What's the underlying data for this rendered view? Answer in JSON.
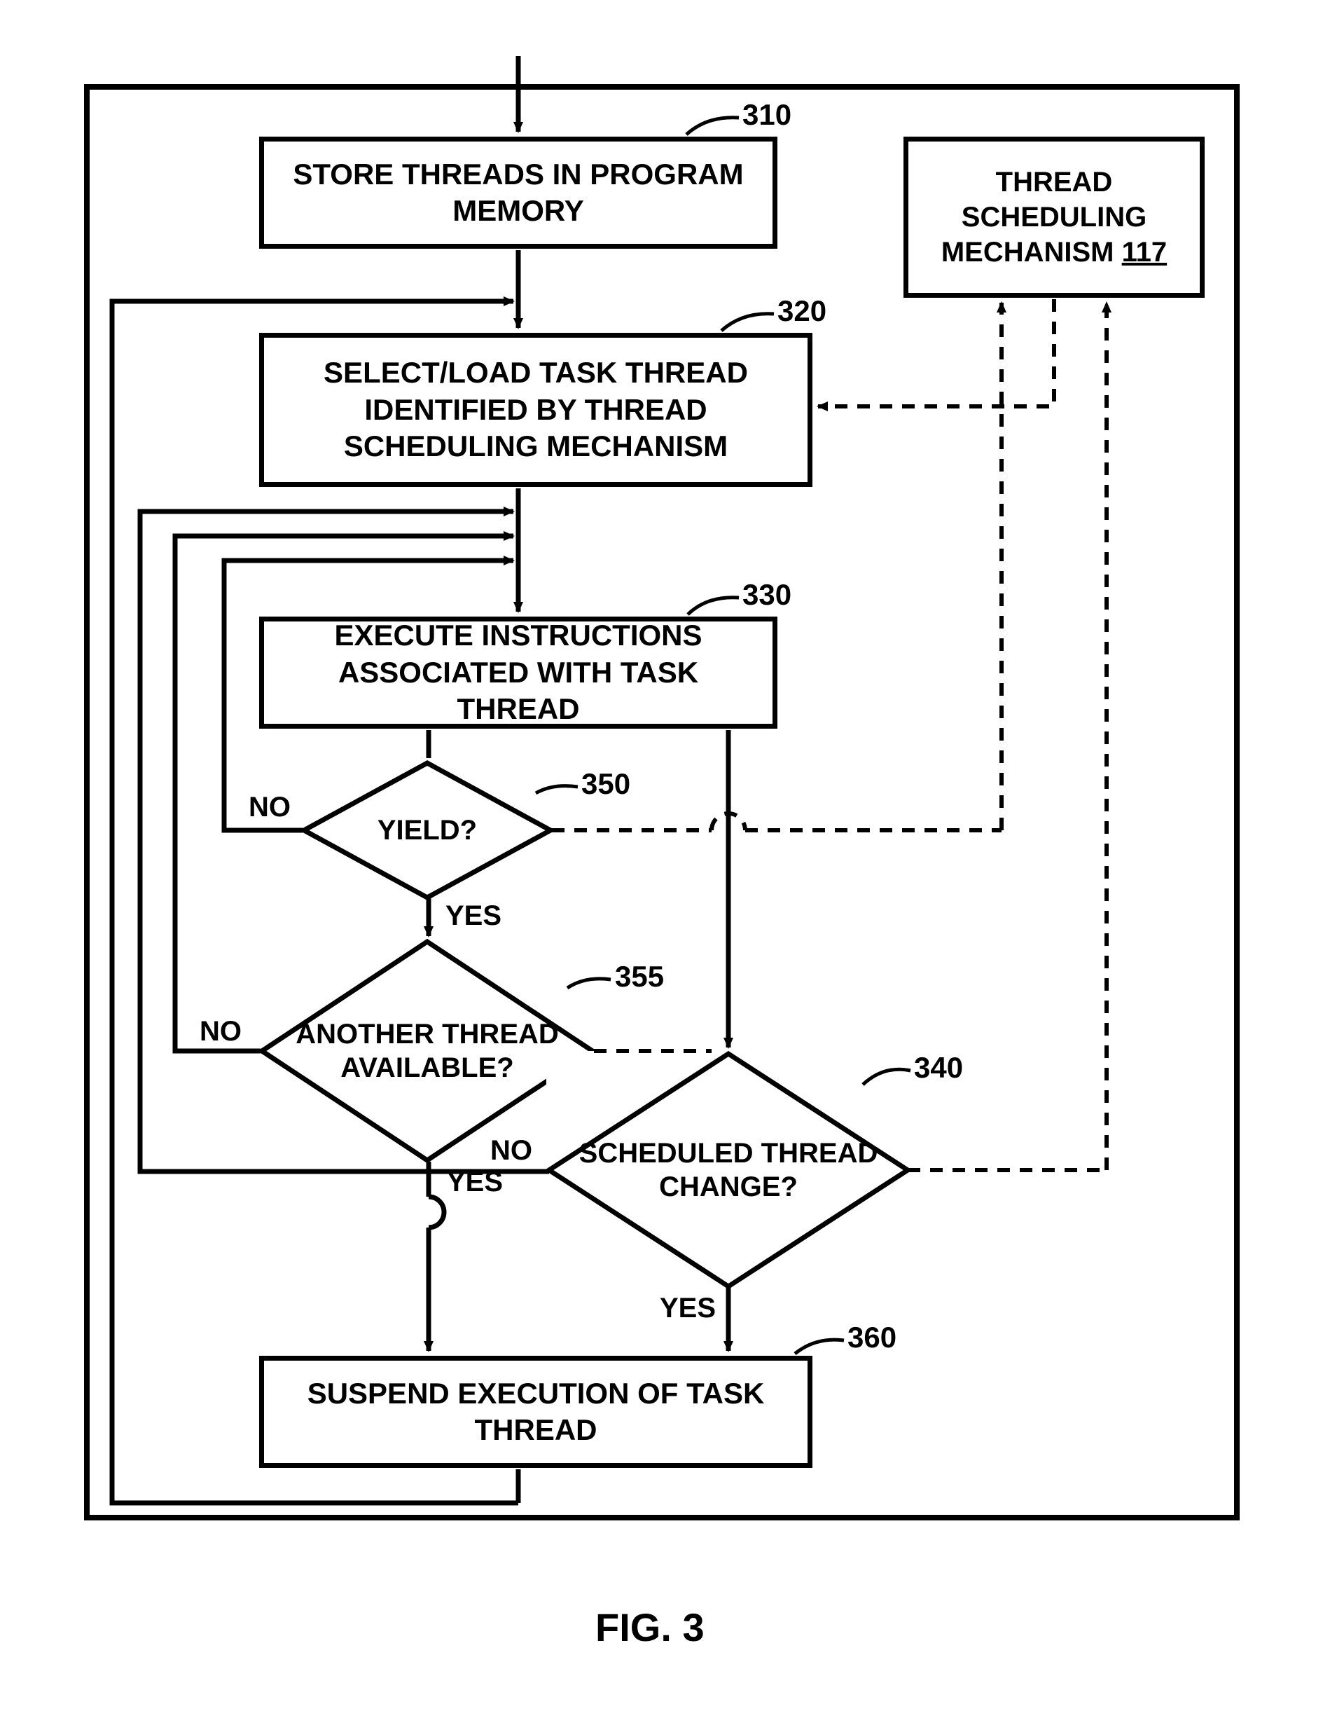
{
  "boxes": {
    "b310": "STORE THREADS IN PROGRAM MEMORY",
    "b320": "SELECT/LOAD TASK THREAD IDENTIFIED BY THREAD SCHEDULING MECHANISM",
    "b330": "EXECUTE INSTRUCTIONS ASSOCIATED WITH TASK THREAD",
    "b360": "SUSPEND EXECUTION OF TASK THREAD",
    "tsm_line1": "THREAD SCHEDULING MECHANISM ",
    "tsm_ref": "117"
  },
  "diamonds": {
    "d350": "YIELD?",
    "d355": "ANOTHER THREAD AVAILABLE?",
    "d340": "SCHEDULED THREAD CHANGE?"
  },
  "labels": {
    "yes": "YES",
    "no": "NO"
  },
  "refs": {
    "r310": "310",
    "r320": "320",
    "r330": "330",
    "r350": "350",
    "r355": "355",
    "r340": "340",
    "r360": "360"
  },
  "figure": "FIG. 3"
}
